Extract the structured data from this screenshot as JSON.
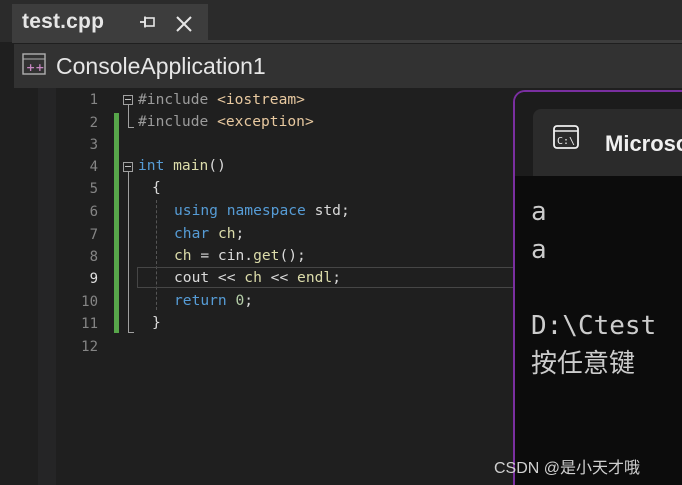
{
  "tab": {
    "title": "test.cpp",
    "pin_icon": "pin-icon",
    "close_icon": "close-icon"
  },
  "project": {
    "name": "ConsoleApplication1",
    "icon": "cpp-project-icon"
  },
  "editor": {
    "current_line": 9,
    "line_numbers": [
      "1",
      "2",
      "3",
      "4",
      "5",
      "6",
      "7",
      "8",
      "9",
      "10",
      "11",
      "12"
    ],
    "lines": [
      {
        "pre": "#include ",
        "inc": "<iostream>"
      },
      {
        "pre": "#include ",
        "inc": "<exception>"
      },
      {},
      {
        "kw": "int",
        "fn": " main",
        "plain": "()"
      },
      {
        "plain": "{"
      },
      {
        "kw1": "using",
        "kw2": " namespace",
        "plain": " std;"
      },
      {
        "kw": "char",
        "fn": " ch",
        "plain": ";"
      },
      {
        "fn": "ch",
        "plain": " = cin.",
        "fn2": "get",
        "plain2": "();"
      },
      {
        "plain": "cout << ",
        "fn": "ch",
        "plain2": " << ",
        "fn2": "endl",
        "plain3": ";"
      },
      {
        "kw": "return",
        "num": " 0",
        "plain": ";"
      },
      {
        "plain": "}"
      },
      {}
    ]
  },
  "console": {
    "tab_title": "Microsoft",
    "icon": "cmd-icon",
    "output": [
      "a",
      "a",
      "",
      "D:\\Ctest",
      "按任意键"
    ]
  },
  "watermark": "CSDN @是小天才哦",
  "colors": {
    "accent_border": "#7a2fa0",
    "change_bar": "#57a64a",
    "keyword": "#569cd6",
    "function": "#dcdcaa"
  }
}
